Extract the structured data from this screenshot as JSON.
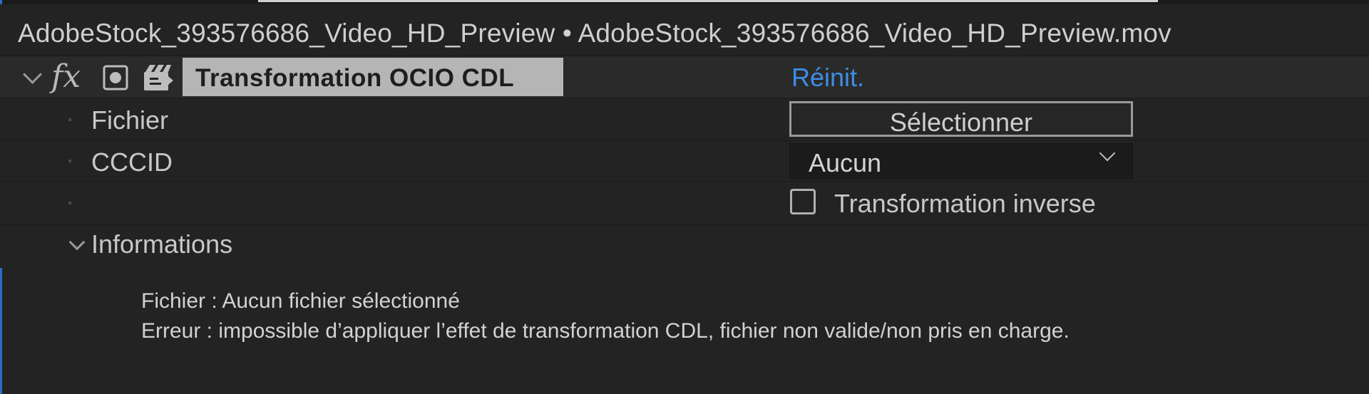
{
  "header": {
    "title": "AdobeStock_393576686_Video_HD_Preview • AdobeStock_393576686_Video_HD_Preview.mov"
  },
  "effect": {
    "fx_symbol": "fx",
    "name": "Transformation OCIO CDL",
    "reset_label": "Réinit.",
    "expanded": true,
    "icons": [
      "chevron-down-icon",
      "fx-icon",
      "mask-icon",
      "film-icon"
    ]
  },
  "properties": {
    "fichier": {
      "label": "Fichier",
      "button_label": "Sélectionner"
    },
    "cccid": {
      "label": "CCCID",
      "selected": "Aucun"
    },
    "inverse": {
      "label": "Transformation inverse",
      "checked": false
    }
  },
  "informations": {
    "label": "Informations",
    "expanded": true,
    "lines": [
      "Fichier : Aucun fichier sélectionné",
      "Erreur : impossible d’appliquer l’effet de transformation CDL, fichier non valide/non pris en charge."
    ]
  },
  "colors": {
    "background": "#232323",
    "effect_row": "#2a2a2a",
    "effect_name_bg": "#b5b5b5",
    "link": "#3d8ee6",
    "accent": "#2d6cc0"
  }
}
